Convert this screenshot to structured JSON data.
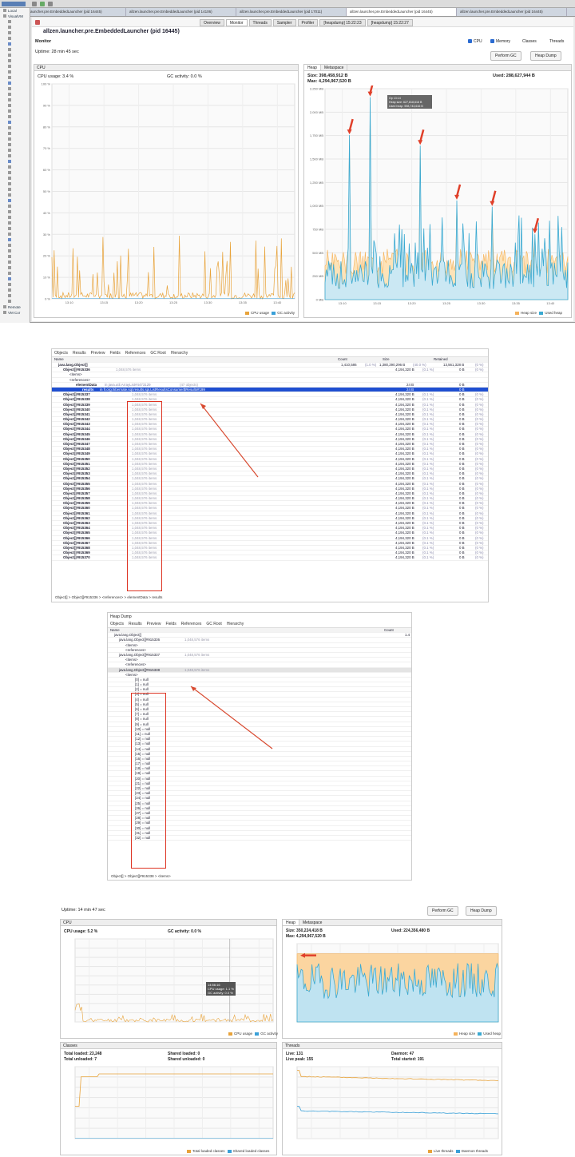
{
  "p1": {
    "window_tabs": [
      "allzen.launcher.pre.EmbeddedLauncher (pid 16445)",
      "allzen.launcher.pre.EmbeddedLauncher (pid 14106)",
      "allzen.launcher.pre.EmbeddedLauncher (pid 17011)",
      "allzen.launcher.pre.EmbeddedLauncher (pid 16445)",
      "allzen.launcher.pre.EmbeddedLauncher (pid 16445)"
    ],
    "tool_tabs": [
      "Overview",
      "Monitor",
      "Threads",
      "Sampler",
      "Profiler",
      "[heapdump] 15:22:23",
      "[heapdump] 15:22:27"
    ],
    "sidebar_items": [
      "Local",
      "VisualVM",
      "",
      "",
      "",
      "",
      "",
      "",
      "",
      "",
      "",
      "",
      "",
      "",
      "",
      "",
      "",
      "",
      "",
      "",
      "",
      "",
      "",
      "",
      "",
      "",
      "",
      "",
      "",
      "",
      "",
      "",
      "",
      "",
      "",
      "",
      "",
      "",
      "",
      "",
      "",
      "",
      "",
      "",
      "",
      "",
      "",
      "",
      "",
      "",
      "",
      "",
      "",
      "Remote",
      "VM Cor"
    ],
    "title": "allzen.launcher.pre.EmbeddedLauncher (pid 16445)",
    "section": "Monitor",
    "uptime": "Uptime: 28 min 45 sec",
    "checks": [
      "CPU",
      "Memory",
      "Classes",
      "Threads"
    ],
    "perform_gc": "Perform GC",
    "heap_dump": "Heap Dump",
    "cpu": {
      "header": "CPU",
      "usage": "CPU usage: 3.4 %",
      "gc": "GC activity: 0.0 %",
      "legend": [
        "CPU usage",
        "GC activity"
      ],
      "yticks": [
        "100 %",
        "90 %",
        "80 %",
        "70 %",
        "60 %",
        "50 %",
        "40 %",
        "30 %",
        "20 %",
        "10 %",
        "0 %"
      ],
      "xticks": [
        "13:10",
        "13:15",
        "13:20",
        "13:25",
        "13:30",
        "13:35",
        "13:40"
      ]
    },
    "heap": {
      "tabs": [
        "Heap",
        "Metaspace"
      ],
      "size": "Size: 398,458,912 B",
      "used": "Used: 288,627,944 B",
      "max": "Max: 4,294,967,520 B",
      "legend": [
        "Heap size",
        "Used heap"
      ],
      "tooltip": [
        "Op 13:14",
        "Heap size: 627,818,616 B",
        "Used heap: 598,743,616 B"
      ],
      "yticks": [
        "2,250 MB",
        "2,000 MB",
        "1,750 MB",
        "1,500 MB",
        "1,250 MB",
        "1,000 MB",
        "750 MB",
        "500 MB",
        "250 MB",
        "0 MB"
      ],
      "xticks": [
        "13:10",
        "13:15",
        "13:20",
        "13:25",
        "13:30",
        "13:35",
        "13:40"
      ]
    }
  },
  "p2": {
    "toolbar": [
      "Objects",
      "Results",
      "Preview",
      "Fields",
      "References",
      "GC Root",
      "Hierarchy"
    ],
    "cols": [
      "Name",
      "Count",
      "Size",
      "Retained"
    ],
    "root": {
      "name": "java.lang.Object[]",
      "count": "1,410,586",
      "count_pct": "(1.0 %)",
      "size": "1,380,290,296 B",
      "size_pct": "(40.0 %)",
      "retained": "13,561,328 B",
      "ret_pct": "(0 %)"
    },
    "first": {
      "name": "Object[]#915336",
      "desc": "1,048,576 items",
      "size": "4,194,320 B",
      "pct": "(0.1 %)",
      "ret": "0 B",
      "ret_pct": "(0 %)"
    },
    "lines": [
      "<items>",
      "<references>"
    ],
    "element": {
      "name": "elementData",
      "desc": "in java.util.ArrayList#4473129",
      "extra": "(47 objects)",
      "size": "24 B",
      "ret": "0 B"
    },
    "selected": {
      "name": "results",
      "desc": "in fr.org.hibernate.sql.results.spi.ListResultsConsumer$Results#199",
      "size": "24 B",
      "ret": "0 B"
    },
    "rows": [
      "Object[]#915337",
      "Object[]#915338",
      "Object[]#915339",
      "Object[]#915340",
      "Object[]#915341",
      "Object[]#915342",
      "Object[]#915343",
      "Object[]#915344",
      "Object[]#915345",
      "Object[]#915346",
      "Object[]#915347",
      "Object[]#915348",
      "Object[]#915349",
      "Object[]#915350",
      "Object[]#915351",
      "Object[]#915352",
      "Object[]#915353",
      "Object[]#915354",
      "Object[]#915355",
      "Object[]#915356",
      "Object[]#915357",
      "Object[]#915358",
      "Object[]#915359",
      "Object[]#915360",
      "Object[]#915361",
      "Object[]#915362",
      "Object[]#915363",
      "Object[]#915364",
      "Object[]#915365",
      "Object[]#915366",
      "Object[]#915367",
      "Object[]#915368",
      "Object[]#915369",
      "Object[]#915370"
    ],
    "row_desc": "1,048,576 items",
    "row_size": "4,194,320 B",
    "row_pct": "(0.1 %)",
    "row_ret": "0 B",
    "row_ret_pct": "(0 %)",
    "breadcrumb": "Object[]  >  Object[]#915336  >  <references>  >  elementData  >  results"
  },
  "p3": {
    "title": "Heap Dump",
    "toolbar": [
      "Objects",
      "Results",
      "Preview",
      "Fields",
      "References",
      "GC Root",
      "Hierarchy"
    ],
    "cols": [
      "Name",
      "Count"
    ],
    "root": {
      "name": "java.lang.Object[]",
      "count": "1.4"
    },
    "items": [
      {
        "name": "java.lang.Object[]#915336",
        "desc": "1,048,576 items"
      },
      {
        "name": "<items>"
      },
      {
        "name": "<references>"
      },
      {
        "name": "java.lang.Object[]#915337",
        "desc": "1,048,576 items"
      },
      {
        "name": "<items>"
      },
      {
        "name": "<references>"
      },
      {
        "name": "java.lang.Object[]#915338",
        "desc": "1,048,576 items"
      },
      {
        "name": "<items>"
      }
    ],
    "nulls": [
      "[0] = null",
      "[1] = null",
      "[2] = null",
      "[3] = null",
      "[4] = null",
      "[5] = null",
      "[6] = null",
      "[7] = null",
      "[8] = null",
      "[9] = null",
      "[10] = null",
      "[11] = null",
      "[12] = null",
      "[13] = null",
      "[14] = null",
      "[15] = null",
      "[16] = null",
      "[17] = null",
      "[18] = null",
      "[19] = null",
      "[20] = null",
      "[21] = null",
      "[22] = null",
      "[23] = null",
      "[24] = null",
      "[25] = null",
      "[26] = null",
      "[27] = null",
      "[28] = null",
      "[29] = null",
      "[30] = null",
      "[31] = null",
      "[32] = null"
    ],
    "breadcrumb": "Object[]  >  Object[]#915338  >  <items>"
  },
  "p4": {
    "uptime": "Uptime: 14 min 47 sec",
    "perform_gc": "Perform GC",
    "heap_dump": "Heap Dump",
    "cpu": {
      "header": "CPU",
      "usage": "CPU usage: 5.2 %",
      "gc": "GC activity: 0.0 %",
      "legend": [
        "CPU usage",
        "GC activity"
      ],
      "tooltip": [
        "14:56:16",
        "CPU usage: 1.1 %",
        "GC activity: 0.0 %"
      ]
    },
    "heap": {
      "tabs": [
        "Heap",
        "Metaspace"
      ],
      "size": "Size: 350,224,418 B",
      "used": "Used: 224,356,480 B",
      "max": "Max: 4,294,967,520 B",
      "legend": [
        "Heap size",
        "Used heap"
      ]
    },
    "classes": {
      "header": "Classes",
      "total_loaded": "Total loaded: 23,248",
      "shared_loaded": "Shared loaded: 0",
      "total_unloaded": "Total unloaded: 7",
      "shared_unloaded": "Shared unloaded: 0",
      "legend": [
        "Total loaded classes",
        "Shared loaded classes"
      ]
    },
    "threads": {
      "header": "Threads",
      "live": "Live: 131",
      "live_peak": "Live peak: 155",
      "daemon": "Daemon: 47",
      "total_started": "Total started: 191",
      "legend": [
        "Live threads",
        "Daemon threads"
      ]
    }
  },
  "colors": {
    "cpu": "#e8a33a",
    "gc": "#3aa0d8",
    "heap_size": "#f5b25a",
    "used_heap": "#3aa9d1",
    "arrow": "#e0402a",
    "select": "#1f4fd1"
  }
}
